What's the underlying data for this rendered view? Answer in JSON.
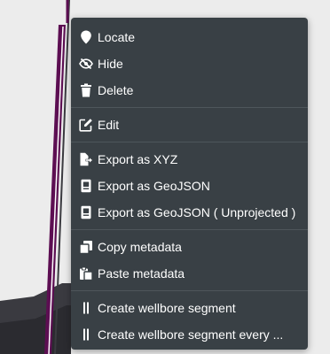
{
  "colors": {
    "menu_bg": "#394045",
    "menu_text": "#ffffff",
    "separator": "#4e565b",
    "wellbore_line": "#5c0e52",
    "background": "#ececec"
  },
  "context_menu": {
    "groups": [
      [
        {
          "label": "Locate",
          "icon": "location-pin-icon"
        },
        {
          "label": "Hide",
          "icon": "eye-slash-icon"
        },
        {
          "label": "Delete",
          "icon": "trash-icon"
        }
      ],
      [
        {
          "label": "Edit",
          "icon": "edit-icon"
        }
      ],
      [
        {
          "label": "Export as XYZ",
          "icon": "file-export-icon"
        },
        {
          "label": "Export as GeoJSON",
          "icon": "file-geojson-icon"
        },
        {
          "label": "Export as GeoJSON ( Unprojected )",
          "icon": "file-geojson-icon"
        }
      ],
      [
        {
          "label": "Copy metadata",
          "icon": "copy-icon"
        },
        {
          "label": "Paste metadata",
          "icon": "paste-icon"
        }
      ],
      [
        {
          "label": "Create wellbore segment",
          "icon": "segment-bars-icon"
        },
        {
          "label": "Create wellbore segment every ...",
          "icon": "segment-bars-icon"
        }
      ]
    ]
  }
}
